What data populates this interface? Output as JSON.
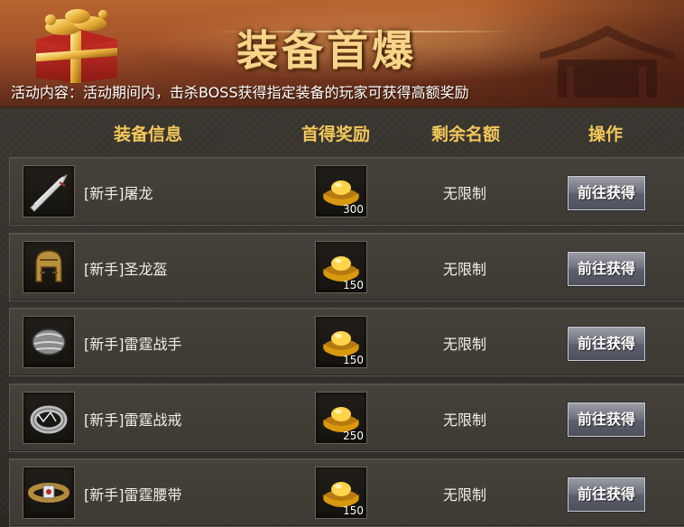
{
  "banner": {
    "title": "装备首爆",
    "description": "活动内容：活动期间内，击杀BOSS获得指定装备的玩家可获得高额奖励"
  },
  "columns": {
    "equipment": "装备信息",
    "reward": "首得奖励",
    "remaining": "剩余名额",
    "action": "操作"
  },
  "rows": [
    {
      "icon": "sword-icon",
      "name": "[新手]屠龙",
      "reward_icon": "gold-ingot-icon",
      "reward_count": "300",
      "remaining": "无限制",
      "action": "前往获得"
    },
    {
      "icon": "helmet-icon",
      "name": "[新手]圣龙盔",
      "reward_icon": "gold-ingot-icon",
      "reward_count": "150",
      "remaining": "无限制",
      "action": "前往获得"
    },
    {
      "icon": "bracer-icon",
      "name": "[新手]雷霆战手",
      "reward_icon": "gold-ingot-icon",
      "reward_count": "150",
      "remaining": "无限制",
      "action": "前往获得"
    },
    {
      "icon": "ring-icon",
      "name": "[新手]雷霆战戒",
      "reward_icon": "gold-ingot-icon",
      "reward_count": "250",
      "remaining": "无限制",
      "action": "前往获得"
    },
    {
      "icon": "belt-icon",
      "name": "[新手]雷霆腰带",
      "reward_icon": "gold-ingot-icon",
      "reward_count": "150",
      "remaining": "无限制",
      "action": "前往获得"
    }
  ],
  "colors": {
    "header_gold": "#f3c75a",
    "title_gold": "#f6d58a",
    "banner_orange": "#a4542a"
  }
}
